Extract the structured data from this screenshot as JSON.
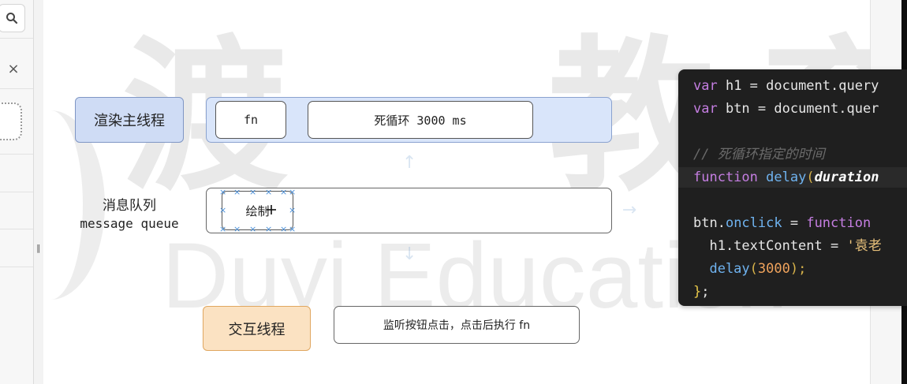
{
  "sidebar": {
    "search_icon": "search-icon",
    "close_glyph": "×",
    "resize_glyph": "‖"
  },
  "watermark": {
    "cn": "渡一教育",
    "en": "Duyi Education"
  },
  "diagram": {
    "main_thread": {
      "label": "渲染主线程",
      "fn": "fn",
      "dead_loop": "死循环 3000 ms"
    },
    "message_queue": {
      "label_cn": "消息队列",
      "label_en": "message queue",
      "task": "绘制"
    },
    "interaction_thread": {
      "label": "交互线程",
      "description": "监听按钮点击，点击后执行 fn"
    }
  },
  "code": {
    "line1": {
      "kw": "var",
      "rest": " h1 = document.query"
    },
    "line2": {
      "kw": "var",
      "rest": " btn = document.quer"
    },
    "comment": "// 死循环指定的时间",
    "line4": {
      "kw": "function",
      "name": " delay",
      "open": "(",
      "param": "duration"
    },
    "line5": {
      "obj": "btn.",
      "prop": "onclick",
      "eq": " = ",
      "kw": "function"
    },
    "line6": {
      "text": "  h1.textContent = ",
      "str": "'袁老"
    },
    "line7": {
      "call": "  delay",
      "open": "(",
      "num": "3000",
      "close": ");"
    },
    "line8": {
      "brace": "}",
      "semi": ";"
    }
  },
  "colors": {
    "main_thread_fill": "#d9e5fa",
    "interaction_fill": "#fbe2c2",
    "code_bg": "#1f1f1f",
    "keyword": "#c57ee2",
    "function_name": "#6fb3f0"
  }
}
